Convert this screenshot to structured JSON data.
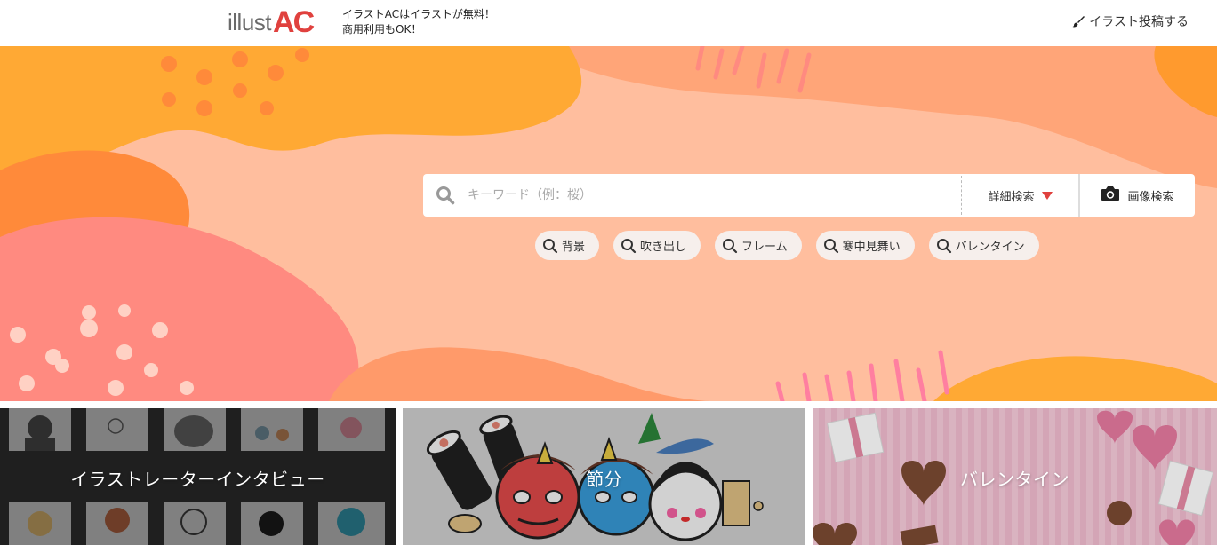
{
  "header": {
    "logo_text": "illust",
    "logo_accent": "AC",
    "tagline_line1": "イラストACはイラストが無料！",
    "tagline_line2": "商用利用もOK！",
    "post_link": "イラスト投稿する",
    "post_icon": "brush-icon"
  },
  "search": {
    "placeholder": "キーワード（例：桜）",
    "value": "",
    "advanced_label": "詳細検索",
    "image_search_label": "画像検索",
    "search_icon": "search-icon",
    "camera_icon": "camera-icon"
  },
  "tags": [
    {
      "label": "背景"
    },
    {
      "label": "吹き出し"
    },
    {
      "label": "フレーム"
    },
    {
      "label": "寒中見舞い"
    },
    {
      "label": "バレンタイン"
    }
  ],
  "banners": [
    {
      "label": "イラストレーターインタビュー"
    },
    {
      "label": "節分"
    },
    {
      "label": "バレンタイン"
    }
  ],
  "colors": {
    "accent": "#e0413e",
    "hero_peach": "#ffbe9e",
    "hero_orange": "#ffa934",
    "hero_coral": "#ff7f5c",
    "hero_pink": "#ff8a80"
  }
}
